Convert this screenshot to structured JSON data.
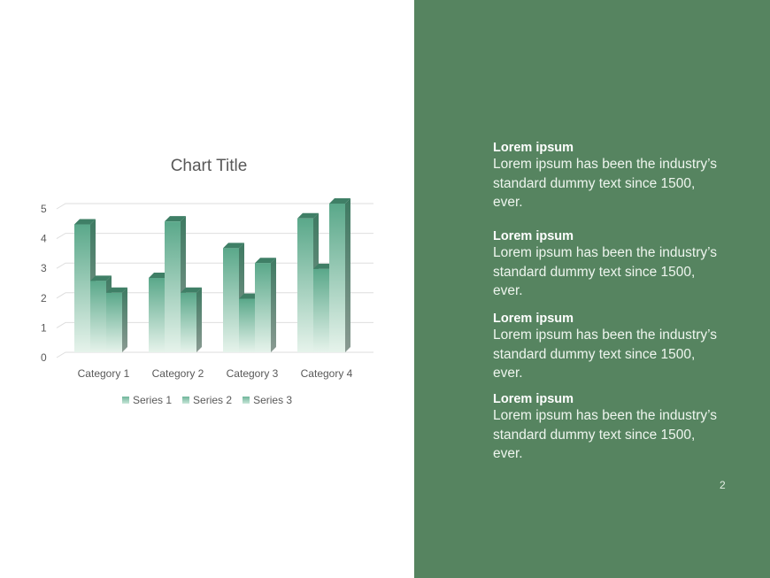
{
  "slide": {
    "page_number": "2",
    "colors": {
      "panel": "#568460",
      "bar_top": "#5aa88a",
      "bar_bottom": "#e4f2ea",
      "bar_side": "#3e7a62"
    }
  },
  "text_blocks": [
    {
      "heading": "Lorem ipsum",
      "body": "Lorem ipsum has been the industry’s standard dummy text since 1500, ever."
    },
    {
      "heading": "Lorem ipsum",
      "body": "Lorem ipsum has been the industry’s standard dummy text since 1500, ever."
    },
    {
      "heading": "Lorem ipsum",
      "body": "Lorem ipsum has been the industry’s standard dummy text since 1500, ever."
    },
    {
      "heading": "Lorem ipsum",
      "body": "Lorem ipsum has been the industry’s standard dummy text since 1500, ever."
    }
  ],
  "chart_data": {
    "type": "bar",
    "title": "Chart Title",
    "categories": [
      "Category 1",
      "Category 2",
      "Category 3",
      "Category 4"
    ],
    "series": [
      {
        "name": "Series 1",
        "values": [
          4.3,
          2.5,
          3.5,
          4.5
        ]
      },
      {
        "name": "Series 2",
        "values": [
          2.4,
          4.4,
          1.8,
          2.8
        ]
      },
      {
        "name": "Series 3",
        "values": [
          2,
          2,
          3,
          5
        ]
      }
    ],
    "ylim": [
      0,
      5
    ],
    "yticks": [
      "0",
      "1",
      "2",
      "3",
      "4",
      "5"
    ],
    "xlabel": "",
    "ylabel": "",
    "grid": true,
    "legend": "bottom",
    "style": "3d-clustered-column"
  }
}
